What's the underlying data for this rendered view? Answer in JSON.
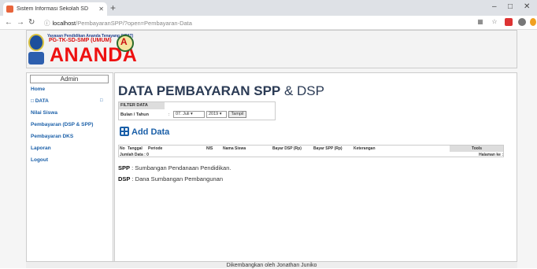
{
  "browser": {
    "tab_title": "Sistem Informasi Sekolah SD",
    "url_host": "localhost",
    "url_path": "/PembayaranSPP/?open=Pembayaran-Data"
  },
  "logo": {
    "line1": "Yayasan Pendidikan Ananda Tenayang (YPAT)",
    "line2": "PG-TK-SD-SMP (UMUM)",
    "name": "ANANDA"
  },
  "sidebar": {
    "heading": "Admin",
    "items": [
      {
        "label": "Home"
      },
      {
        "label": "DATA"
      },
      {
        "label": "Nilai Siswa"
      },
      {
        "label": "Pembayaran (DSP & SPP)"
      },
      {
        "label": "Pembayaran DKS"
      },
      {
        "label": "Laporan"
      },
      {
        "label": "Logout"
      }
    ]
  },
  "main": {
    "title_bold": "DATA PEMBAYARAN SPP",
    "title_light": " & DSP",
    "filter": {
      "heading": "FILTER DATA",
      "label": "Bulan / Tahun",
      "colon": ":",
      "month": "07. Juli",
      "year": "2019",
      "button": "Tampil"
    },
    "add_label": "Add Data",
    "table": {
      "columns": [
        "No",
        "Tanggal",
        "Periode",
        "NIS",
        "Nama Siswa",
        "Bayar DSP (Rp)",
        "Bayar SPP (Rp)",
        "Keterangan",
        "Tools"
      ],
      "jumlah": "Jumlah Data : 0",
      "halaman": "Halaman ke :"
    },
    "legend": [
      {
        "key": "SPP",
        "desc": " : Sumbangan Pendanaan Pendidikan."
      },
      {
        "key": "DSP",
        "desc": " : Dana Sumbangan Pembangunan"
      }
    ]
  },
  "footer": "Dikembangkan oleh Jonathan Juniko"
}
